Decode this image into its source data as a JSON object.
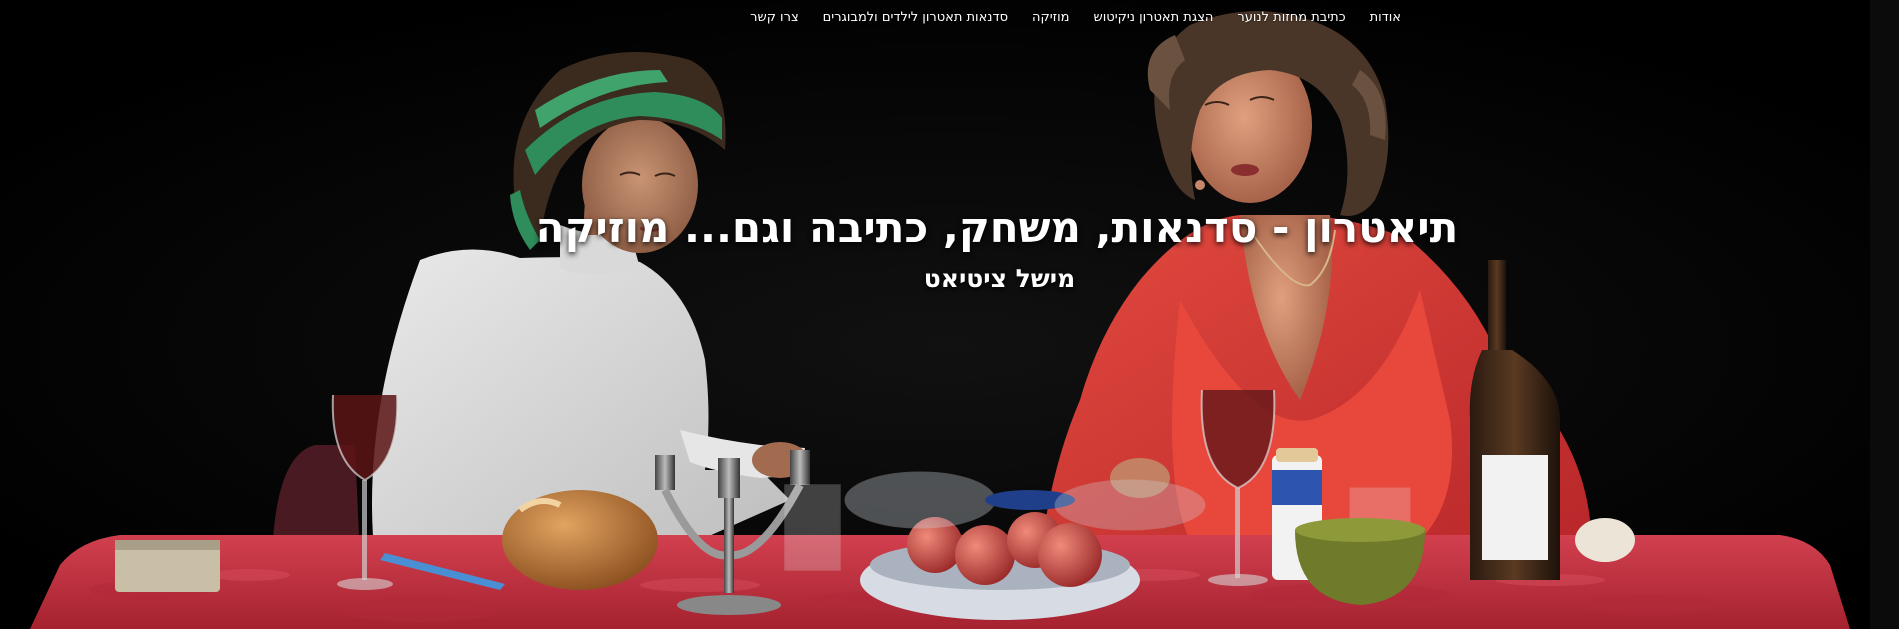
{
  "nav": {
    "items": [
      {
        "label": "אודות"
      },
      {
        "label": "כתיבת מחזות לנוער"
      },
      {
        "label": "הצגת תאטרון ניקיטוש"
      },
      {
        "label": "מוזיקה"
      },
      {
        "label": "סדנאות תאטרון לילדים ולמבוגרים"
      },
      {
        "label": "צרו קשר"
      }
    ]
  },
  "hero": {
    "title": "תיאטרון - סדנאות, משחק, כתיבה וגם... מוזיקה",
    "subtitle": "מישל ציטיאט"
  },
  "colors": {
    "background": "#000000",
    "tablecloth": "#c4303f",
    "accent_red_cardigan": "#d9413a",
    "text": "#ffffff"
  }
}
